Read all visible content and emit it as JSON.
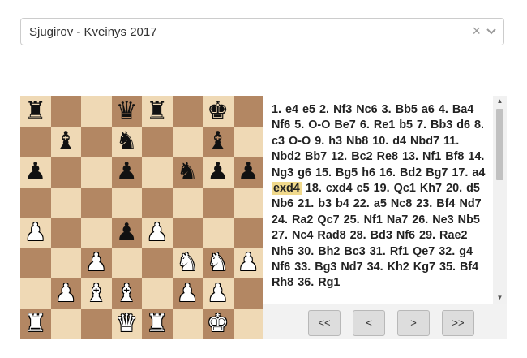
{
  "game_select": {
    "value": "Sjugirov - Kveinys 2017",
    "clear_symbol": "×"
  },
  "board": {
    "colors": {
      "light": "#efd9b5",
      "dark": "#b38763"
    },
    "pieces_by_rank": [
      [
        "bR",
        "",
        "",
        "bQ",
        "bR",
        "",
        "bK",
        ""
      ],
      [
        "",
        "bB",
        "",
        "bN",
        "",
        "",
        "bB",
        ""
      ],
      [
        "bP",
        "",
        "",
        "bP",
        "",
        "bN",
        "bP",
        "bP"
      ],
      [
        "",
        "",
        "",
        "",
        "",
        "",
        "",
        ""
      ],
      [
        "wP",
        "",
        "",
        "bP",
        "wP",
        "",
        "",
        ""
      ],
      [
        "",
        "",
        "wP",
        "",
        "",
        "wN",
        "wN",
        "wP"
      ],
      [
        "",
        "wP",
        "wB",
        "wB",
        "",
        "wP",
        "wP",
        ""
      ],
      [
        "wR",
        "",
        "",
        "wQ",
        "wR",
        "",
        "wK",
        ""
      ]
    ],
    "glyphs": {
      "K": "♚",
      "Q": "♛",
      "R": "♜",
      "B": "♝",
      "N": "♞",
      "P": "♟"
    }
  },
  "moves": {
    "tokens": [
      "1.",
      "e4",
      "e5",
      "2.",
      "Nf3",
      "Nc6",
      "3.",
      "Bb5",
      "a6",
      "4.",
      "Ba4",
      "Nf6",
      "5.",
      "O-O",
      "Be7",
      "6.",
      "Re1",
      "b5",
      "7.",
      "Bb3",
      "d6",
      "8.",
      "c3",
      "O-O",
      "9.",
      "h3",
      "Nb8",
      "10.",
      "d4",
      "Nbd7",
      "11.",
      "Nbd2",
      "Bb7",
      "12.",
      "Bc2",
      "Re8",
      "13.",
      "Nf1",
      "Bf8",
      "14.",
      "Ng3",
      "g6",
      "15.",
      "Bg5",
      "h6",
      "16.",
      "Bd2",
      "Bg7",
      "17.",
      "a4",
      "exd4",
      "18.",
      "cxd4",
      "c5",
      "19.",
      "Qc1",
      "Kh7",
      "20.",
      "d5",
      "Nb6",
      "21.",
      "b3",
      "b4",
      "22.",
      "a5",
      "Nc8",
      "23.",
      "Bf4",
      "Nd7",
      "24.",
      "Ra2",
      "Qc7",
      "25.",
      "Nf1",
      "Na7",
      "26.",
      "Ne3",
      "Nb5",
      "27.",
      "Nc4",
      "Rad8",
      "28.",
      "Bd3",
      "Nf6",
      "29.",
      "Rae2",
      "Nh5",
      "30.",
      "Bh2",
      "Bc3",
      "31.",
      "Rf1",
      "Qe7",
      "32.",
      "g4",
      "Nf6",
      "33.",
      "Bg3",
      "Nd7",
      "34.",
      "Kh2",
      "Kg7",
      "35.",
      "Bf4",
      "Rh8",
      "36.",
      "Rg1"
    ],
    "current_index": 50,
    "highlight_color": "#f0d98c"
  },
  "navigation": {
    "first": "<<",
    "prev": "<",
    "next": ">",
    "last": ">>"
  }
}
